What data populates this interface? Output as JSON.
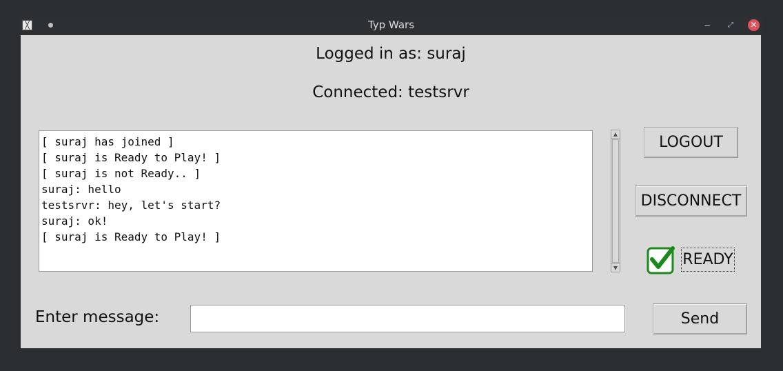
{
  "window": {
    "title": "Typ Wars",
    "controls": {
      "minimize": "−",
      "maximize": "⤢",
      "close": "✕"
    }
  },
  "header": {
    "logged_in": "Logged in as: suraj",
    "connected": "Connected: testsrvr"
  },
  "chat": {
    "lines": [
      "[ suraj has joined ]",
      "[ suraj is Ready to Play! ]",
      "[ suraj is not Ready.. ]",
      "suraj: hello",
      "testsrvr: hey, let's start?",
      "suraj: ok!",
      "[ suraj is Ready to Play! ]"
    ]
  },
  "buttons": {
    "logout": "LOGOUT",
    "disconnect": "DISCONNECT",
    "send": "Send"
  },
  "ready": {
    "label": "READY",
    "checked": true,
    "check_color": "#1a8a1a"
  },
  "message": {
    "label": "Enter message:",
    "value": "",
    "placeholder": ""
  },
  "icons": {
    "app": "app-icon",
    "pin": "pin-icon",
    "check": "checkmark-icon"
  }
}
